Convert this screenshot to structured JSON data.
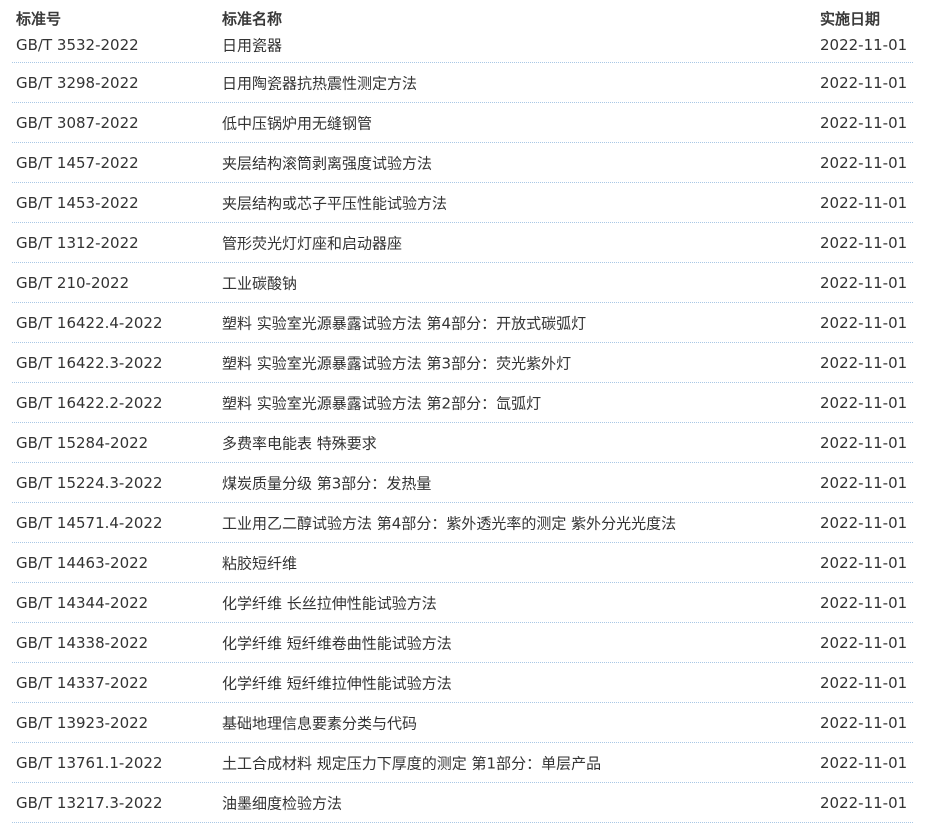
{
  "table": {
    "headers": {
      "code": "标准号",
      "name": "标准名称",
      "date": "实施日期"
    },
    "rows": [
      {
        "code": "GB/T 3532-2022",
        "name": "日用瓷器",
        "date": "2022-11-01"
      },
      {
        "code": "GB/T 3298-2022",
        "name": "日用陶瓷器抗热震性测定方法",
        "date": "2022-11-01"
      },
      {
        "code": "GB/T 3087-2022",
        "name": "低中压锅炉用无缝钢管",
        "date": "2022-11-01"
      },
      {
        "code": "GB/T 1457-2022",
        "name": "夹层结构滚筒剥离强度试验方法",
        "date": "2022-11-01"
      },
      {
        "code": "GB/T 1453-2022",
        "name": "夹层结构或芯子平压性能试验方法",
        "date": "2022-11-01"
      },
      {
        "code": "GB/T 1312-2022",
        "name": "管形荧光灯灯座和启动器座",
        "date": "2022-11-01"
      },
      {
        "code": "GB/T 210-2022",
        "name": "工业碳酸钠",
        "date": "2022-11-01"
      },
      {
        "code": "GB/T 16422.4-2022",
        "name": "塑料 实验室光源暴露试验方法 第4部分：开放式碳弧灯",
        "date": "2022-11-01"
      },
      {
        "code": "GB/T 16422.3-2022",
        "name": "塑料 实验室光源暴露试验方法 第3部分：荧光紫外灯",
        "date": "2022-11-01"
      },
      {
        "code": "GB/T 16422.2-2022",
        "name": "塑料 实验室光源暴露试验方法 第2部分：氙弧灯",
        "date": "2022-11-01"
      },
      {
        "code": "GB/T 15284-2022",
        "name": "多费率电能表 特殊要求",
        "date": "2022-11-01"
      },
      {
        "code": "GB/T 15224.3-2022",
        "name": "煤炭质量分级 第3部分：发热量",
        "date": "2022-11-01"
      },
      {
        "code": "GB/T 14571.4-2022",
        "name": "工业用乙二醇试验方法 第4部分：紫外透光率的测定 紫外分光光度法",
        "date": "2022-11-01"
      },
      {
        "code": "GB/T 14463-2022",
        "name": "粘胶短纤维",
        "date": "2022-11-01"
      },
      {
        "code": "GB/T 14344-2022",
        "name": "化学纤维 长丝拉伸性能试验方法",
        "date": "2022-11-01"
      },
      {
        "code": "GB/T 14338-2022",
        "name": "化学纤维 短纤维卷曲性能试验方法",
        "date": "2022-11-01"
      },
      {
        "code": "GB/T 14337-2022",
        "name": "化学纤维 短纤维拉伸性能试验方法",
        "date": "2022-11-01"
      },
      {
        "code": "GB/T 13923-2022",
        "name": "基础地理信息要素分类与代码",
        "date": "2022-11-01"
      },
      {
        "code": "GB/T 13761.1-2022",
        "name": "土工合成材料 规定压力下厚度的测定 第1部分：单层产品",
        "date": "2022-11-01"
      },
      {
        "code": "GB/T 13217.3-2022",
        "name": "油墨细度检验方法",
        "date": "2022-11-01"
      }
    ]
  }
}
